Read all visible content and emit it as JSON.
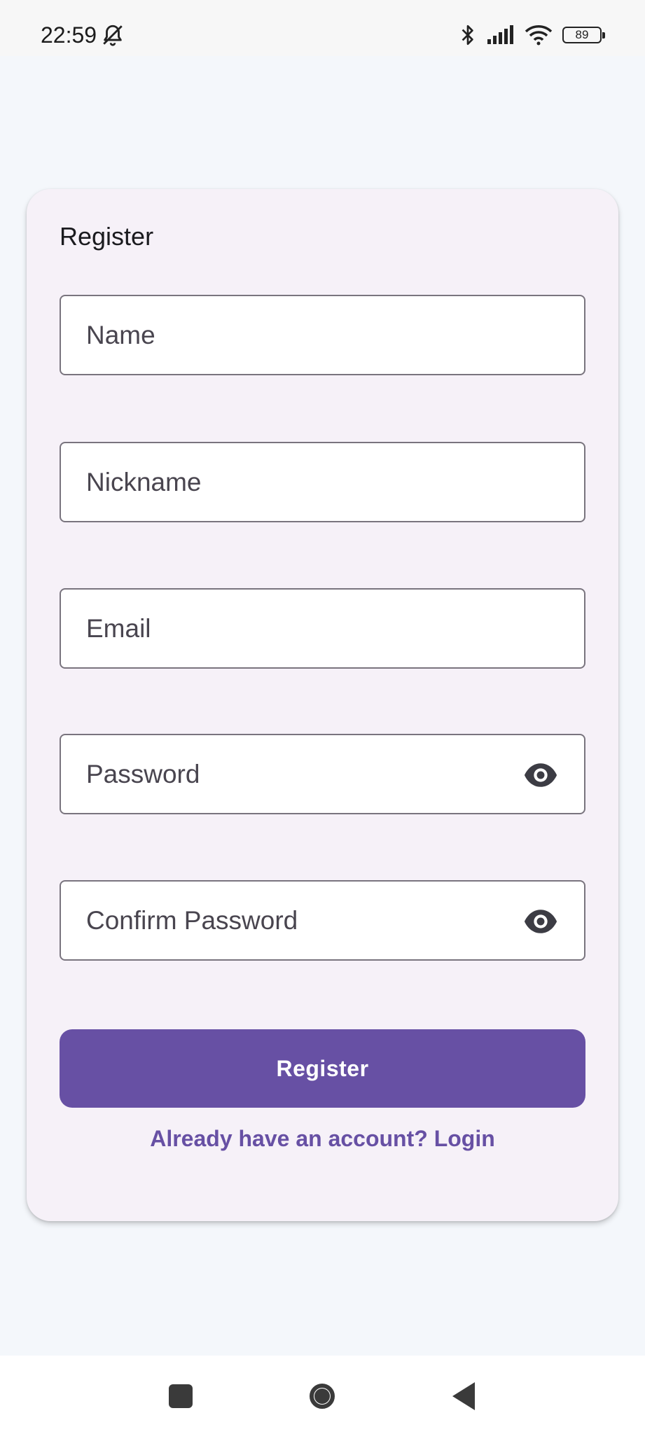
{
  "status_bar": {
    "time": "22:59",
    "battery_level": "89",
    "icons": [
      "bell-off-icon",
      "bluetooth-icon",
      "signal-icon",
      "wifi-icon",
      "battery-icon"
    ]
  },
  "form": {
    "title": "Register",
    "fields": [
      {
        "name": "name",
        "placeholder": "Name",
        "value": ""
      },
      {
        "name": "nickname",
        "placeholder": "Nickname",
        "value": ""
      },
      {
        "name": "email",
        "placeholder": "Email",
        "value": ""
      },
      {
        "name": "password",
        "placeholder": "Password",
        "value": "",
        "trailing_icon": "eye-icon"
      },
      {
        "name": "confirm_password",
        "placeholder": "Confirm Password",
        "value": "",
        "trailing_icon": "eye-icon"
      }
    ],
    "submit_label": "Register",
    "login_link": "Already have an account? Login"
  },
  "nav_bar": {
    "buttons": [
      "recents-square-icon",
      "home-circle-icon",
      "back-triangle-icon"
    ]
  },
  "colors": {
    "primary": "#6750a4",
    "card_background": "#f6f1f8",
    "page_background": "#f4f7fb",
    "field_border": "#79747e"
  }
}
